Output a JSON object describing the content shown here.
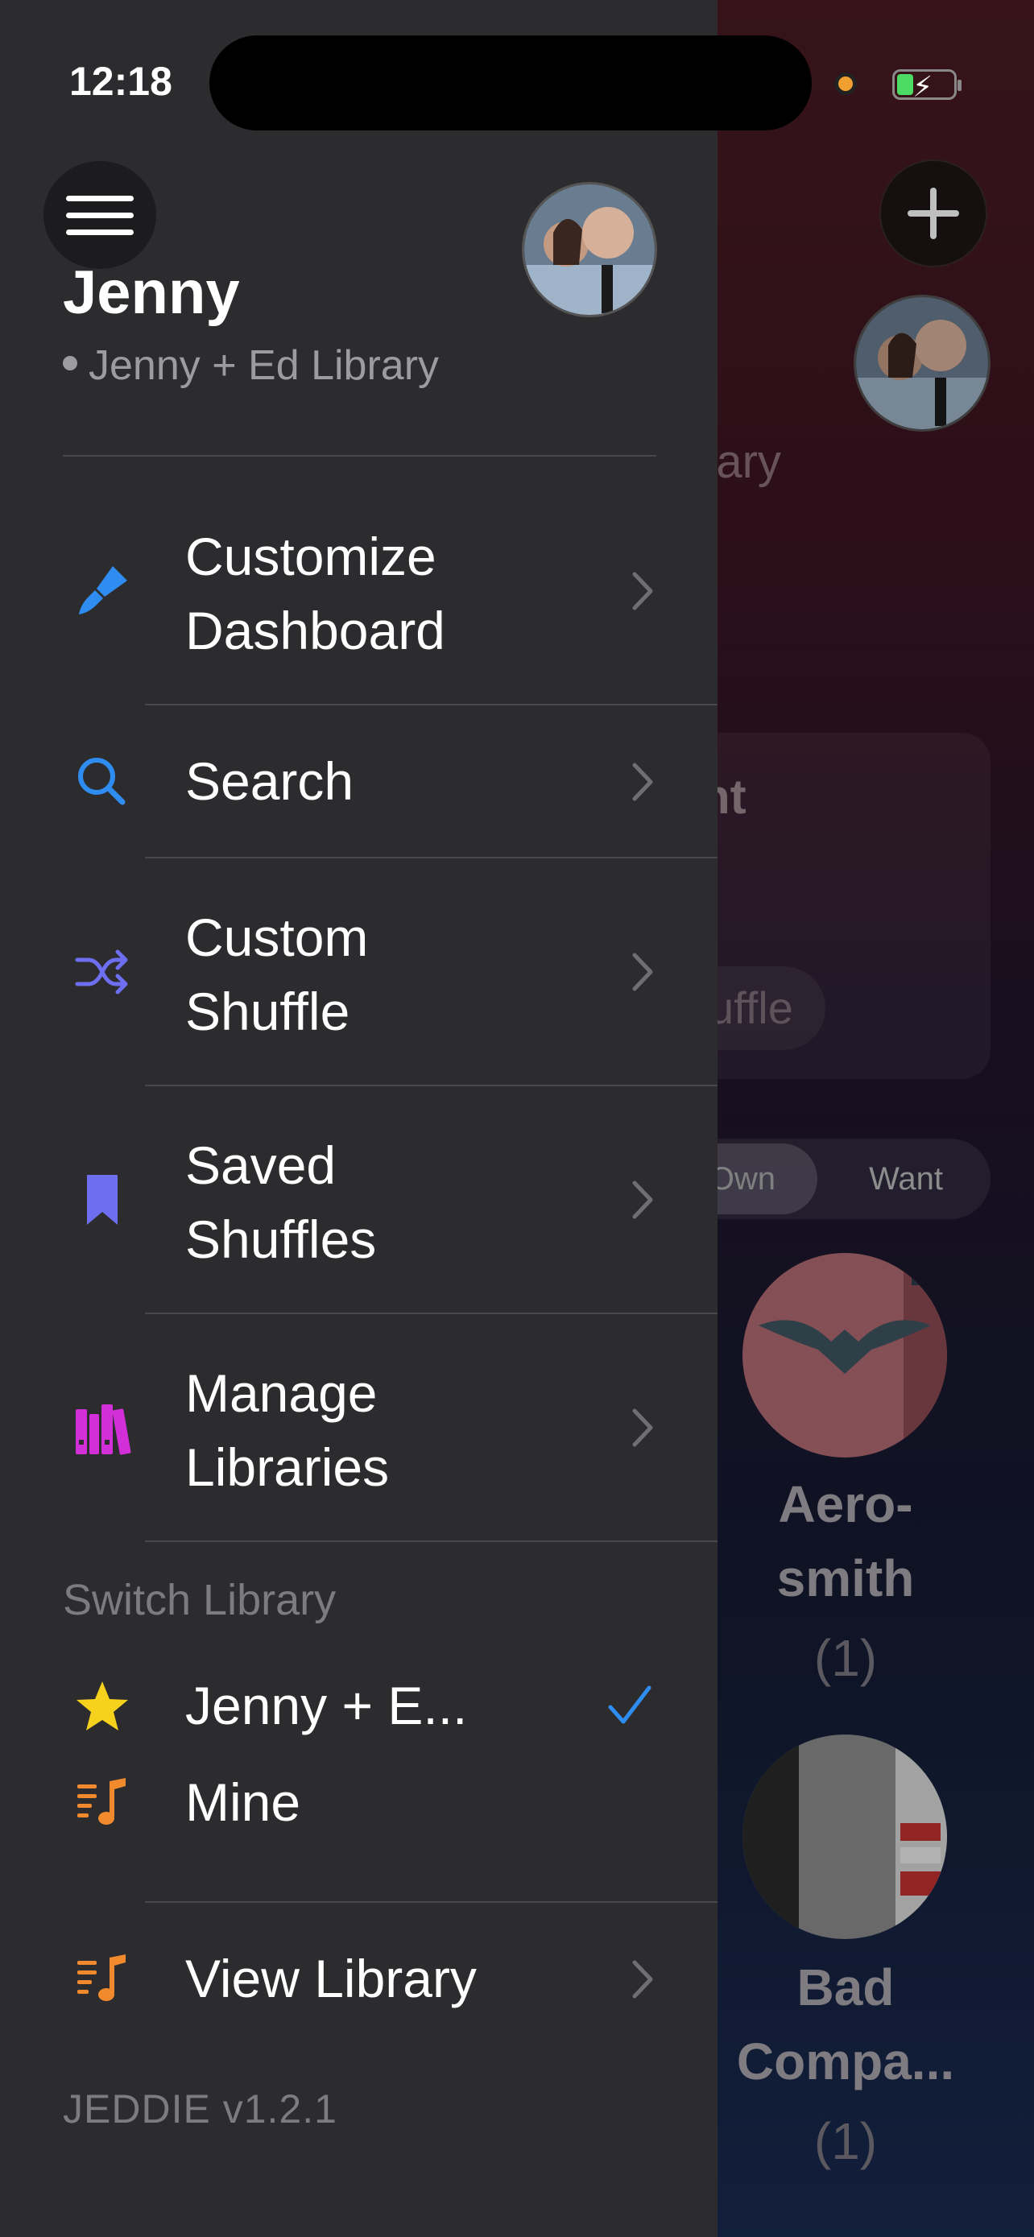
{
  "status_bar": {
    "time": "12:18"
  },
  "drawer": {
    "user_name": "Jenny",
    "current_library": "Jenny + Ed Library",
    "menu": [
      {
        "label": "Customize Dashboard",
        "line1": "Customize",
        "line2": "Dashboard",
        "icon": "paintbrush-icon",
        "color": "#2f8cf0"
      },
      {
        "label": "Search",
        "line1": "Search",
        "icon": "search-icon",
        "color": "#2f8cf0"
      },
      {
        "label": "Custom Shuffle",
        "line1": "Custom",
        "line2": "Shuffle",
        "icon": "shuffle-icon",
        "color": "#6e6ef0"
      },
      {
        "label": "Saved Shuffles",
        "line1": "Saved",
        "line2": "Shuffles",
        "icon": "bookmark-icon",
        "color": "#6e6ef0"
      },
      {
        "label": "Manage Libraries",
        "line1": "Manage",
        "line2": "Libraries",
        "icon": "books-icon",
        "color": "#d22fd8"
      }
    ],
    "switch_library_header": "Switch Library",
    "libraries": [
      {
        "label": "Jenny + E...",
        "icon": "star-icon",
        "color": "#f7d21c",
        "selected": true
      },
      {
        "label": "Mine",
        "icon": "music-list-icon",
        "color": "#f08a2c",
        "selected": false
      }
    ],
    "view_library": {
      "label": "View Library",
      "icon": "music-list-icon",
      "color": "#f08a2c"
    },
    "version": "JEDDIE v1.2.1"
  },
  "background_app": {
    "library_label_fragment": "rary",
    "card_title_fragment": "nt",
    "shuffle_fragment": "uffle",
    "segment": {
      "own_fragment": "Own",
      "want": "Want"
    },
    "artists": [
      {
        "name_line1": "Aero-",
        "name_line2": "smith",
        "count": "(1)"
      },
      {
        "name_line1": "Bad",
        "name_line2": "Compa...",
        "count": "(1)"
      }
    ]
  }
}
